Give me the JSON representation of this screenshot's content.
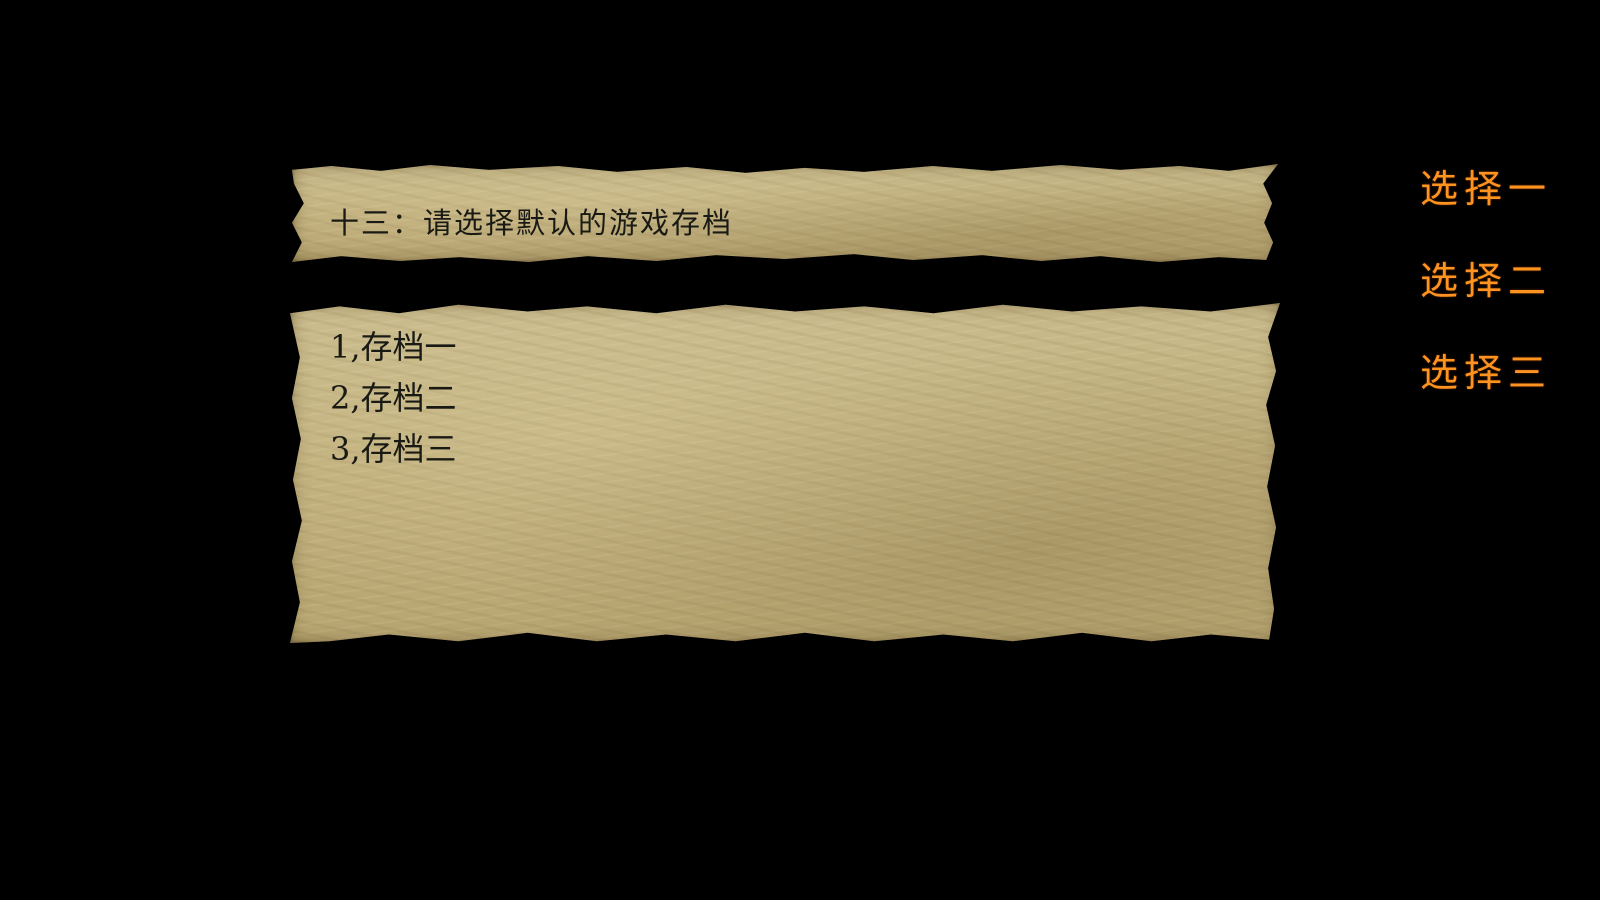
{
  "dialog": {
    "prompt": "十三：请选择默认的游戏存档",
    "saves": [
      {
        "label": "1,存档一"
      },
      {
        "label": "2,存档二"
      },
      {
        "label": "3,存档三"
      }
    ]
  },
  "menu": {
    "options": [
      {
        "label": "选择一"
      },
      {
        "label": "选择二"
      },
      {
        "label": "选择三"
      }
    ]
  },
  "colors": {
    "background": "#000000",
    "parchment": "#c2b281",
    "text": "#1a1a14",
    "option_text": "#ff9320"
  }
}
